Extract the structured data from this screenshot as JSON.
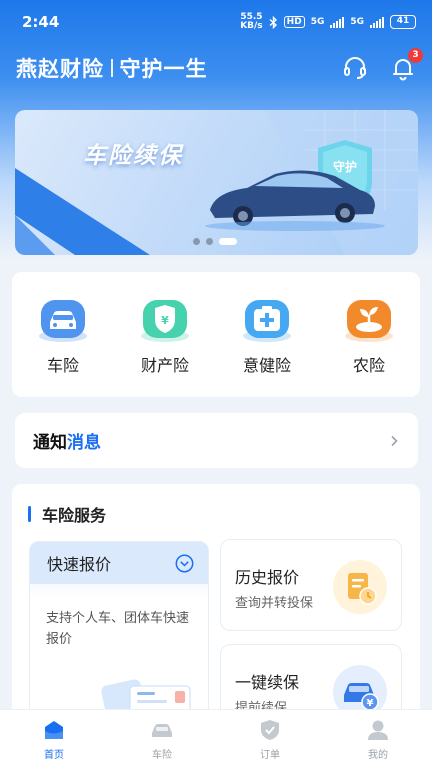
{
  "status_bar": {
    "time": "2:44",
    "net_speed_value": "55.5",
    "net_speed_unit": "KB/s",
    "hd_label": "HD",
    "signal1_label": "5G",
    "signal2_label": "5G",
    "battery": "41"
  },
  "header": {
    "brand": "燕赵财险",
    "slogan": "守护一生",
    "notification_count": "3"
  },
  "banner": {
    "title": "车险续保",
    "shield_text": "守护",
    "page_count": 3,
    "active_page": 3
  },
  "insurance_types": [
    {
      "label": "车险",
      "icon": "car-insurance-icon"
    },
    {
      "label": "财产险",
      "icon": "property-insurance-icon"
    },
    {
      "label": "意健险",
      "icon": "health-insurance-icon"
    },
    {
      "label": "农险",
      "icon": "agriculture-insurance-icon"
    }
  ],
  "notice": {
    "prefix": "通知",
    "highlight": "消息"
  },
  "service": {
    "title": "车险服务",
    "quick_quote": {
      "title": "快速报价",
      "description": "支持个人车、团体车快速报价"
    },
    "history_quote": {
      "title": "历史报价",
      "subtitle": "查询并转投保"
    },
    "renewal": {
      "title": "一键续保",
      "subtitle": "提前续保"
    }
  },
  "tabbar": {
    "items": [
      {
        "label": "首页",
        "active": true
      },
      {
        "label": "车险",
        "active": false
      },
      {
        "label": "订单",
        "active": false
      },
      {
        "label": "我的",
        "active": false
      }
    ]
  },
  "colors": {
    "primary": "#1a6ef0",
    "header_blue": "#1e78ea",
    "badge_red": "#f03a3a",
    "agri_orange": "#f28a2b",
    "health_teal": "#3aa9f0",
    "property_green": "#3fcfa8"
  }
}
